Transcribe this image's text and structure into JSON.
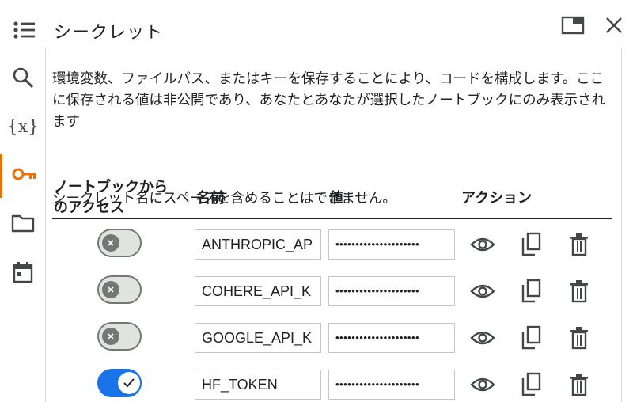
{
  "panel": {
    "title": "シークレット",
    "description": "環境変数、ファイルパス、またはキーを保存することにより、コードを構成します。ここに保存される値は非公開であり、あなたとあなたが選択したノートブックにのみ表示されます",
    "note": "シークレット名にスペースを含めることはできません。"
  },
  "icons": {
    "menu": "list-icon",
    "pane": "open-in-pane-icon",
    "close": "close-icon",
    "search": "search-icon",
    "variables": "variables-icon",
    "secrets": "key-icon",
    "files": "folder-icon",
    "calendar": "calendar-icon",
    "view": "eye-icon",
    "copy": "copy-icon",
    "delete": "trash-icon"
  },
  "rail": {
    "variables_glyph": "{x}"
  },
  "table": {
    "headers": {
      "access": "ノートブックからのアクセス",
      "name": "名前",
      "value": "値",
      "action": "アクション"
    },
    "rows": [
      {
        "enabled": false,
        "name": "ANTHROPIC_AP",
        "value": "•••••••••••••••••••••"
      },
      {
        "enabled": false,
        "name": "COHERE_API_K",
        "value": "•••••••••••••••••••••"
      },
      {
        "enabled": false,
        "name": "GOOGLE_API_K",
        "value": "•••••••••••••••••••••"
      },
      {
        "enabled": true,
        "name": "HF_TOKEN",
        "value": "•••••••••••••••••••••"
      }
    ]
  },
  "colors": {
    "accent": "#e8710a",
    "toggle_on": "#1a73e8",
    "toggle_off": "#747775",
    "icon": "#444746"
  }
}
